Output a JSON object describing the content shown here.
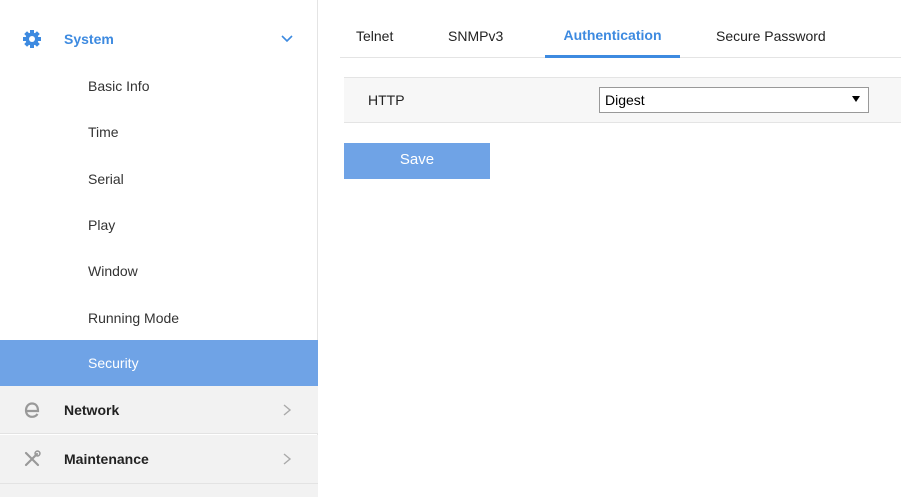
{
  "sidebar": {
    "system": {
      "label": "System",
      "icon": "gear-icon"
    },
    "items": [
      {
        "label": "Basic Info"
      },
      {
        "label": "Time"
      },
      {
        "label": "Serial"
      },
      {
        "label": "Play"
      },
      {
        "label": "Window"
      },
      {
        "label": "Running Mode"
      },
      {
        "label": "Security"
      }
    ],
    "network": {
      "label": "Network",
      "icon": "e-icon"
    },
    "maintenance": {
      "label": "Maintenance",
      "icon": "tools-icon"
    }
  },
  "tabs": [
    {
      "label": "Telnet"
    },
    {
      "label": "SNMPv3"
    },
    {
      "label": "Authentication"
    },
    {
      "label": "Secure Password"
    }
  ],
  "form": {
    "http_label": "HTTP",
    "http_value": "Digest"
  },
  "save_label": "Save",
  "colors": {
    "accent": "#3d8ae0",
    "active_bg": "#6fa3e6"
  }
}
